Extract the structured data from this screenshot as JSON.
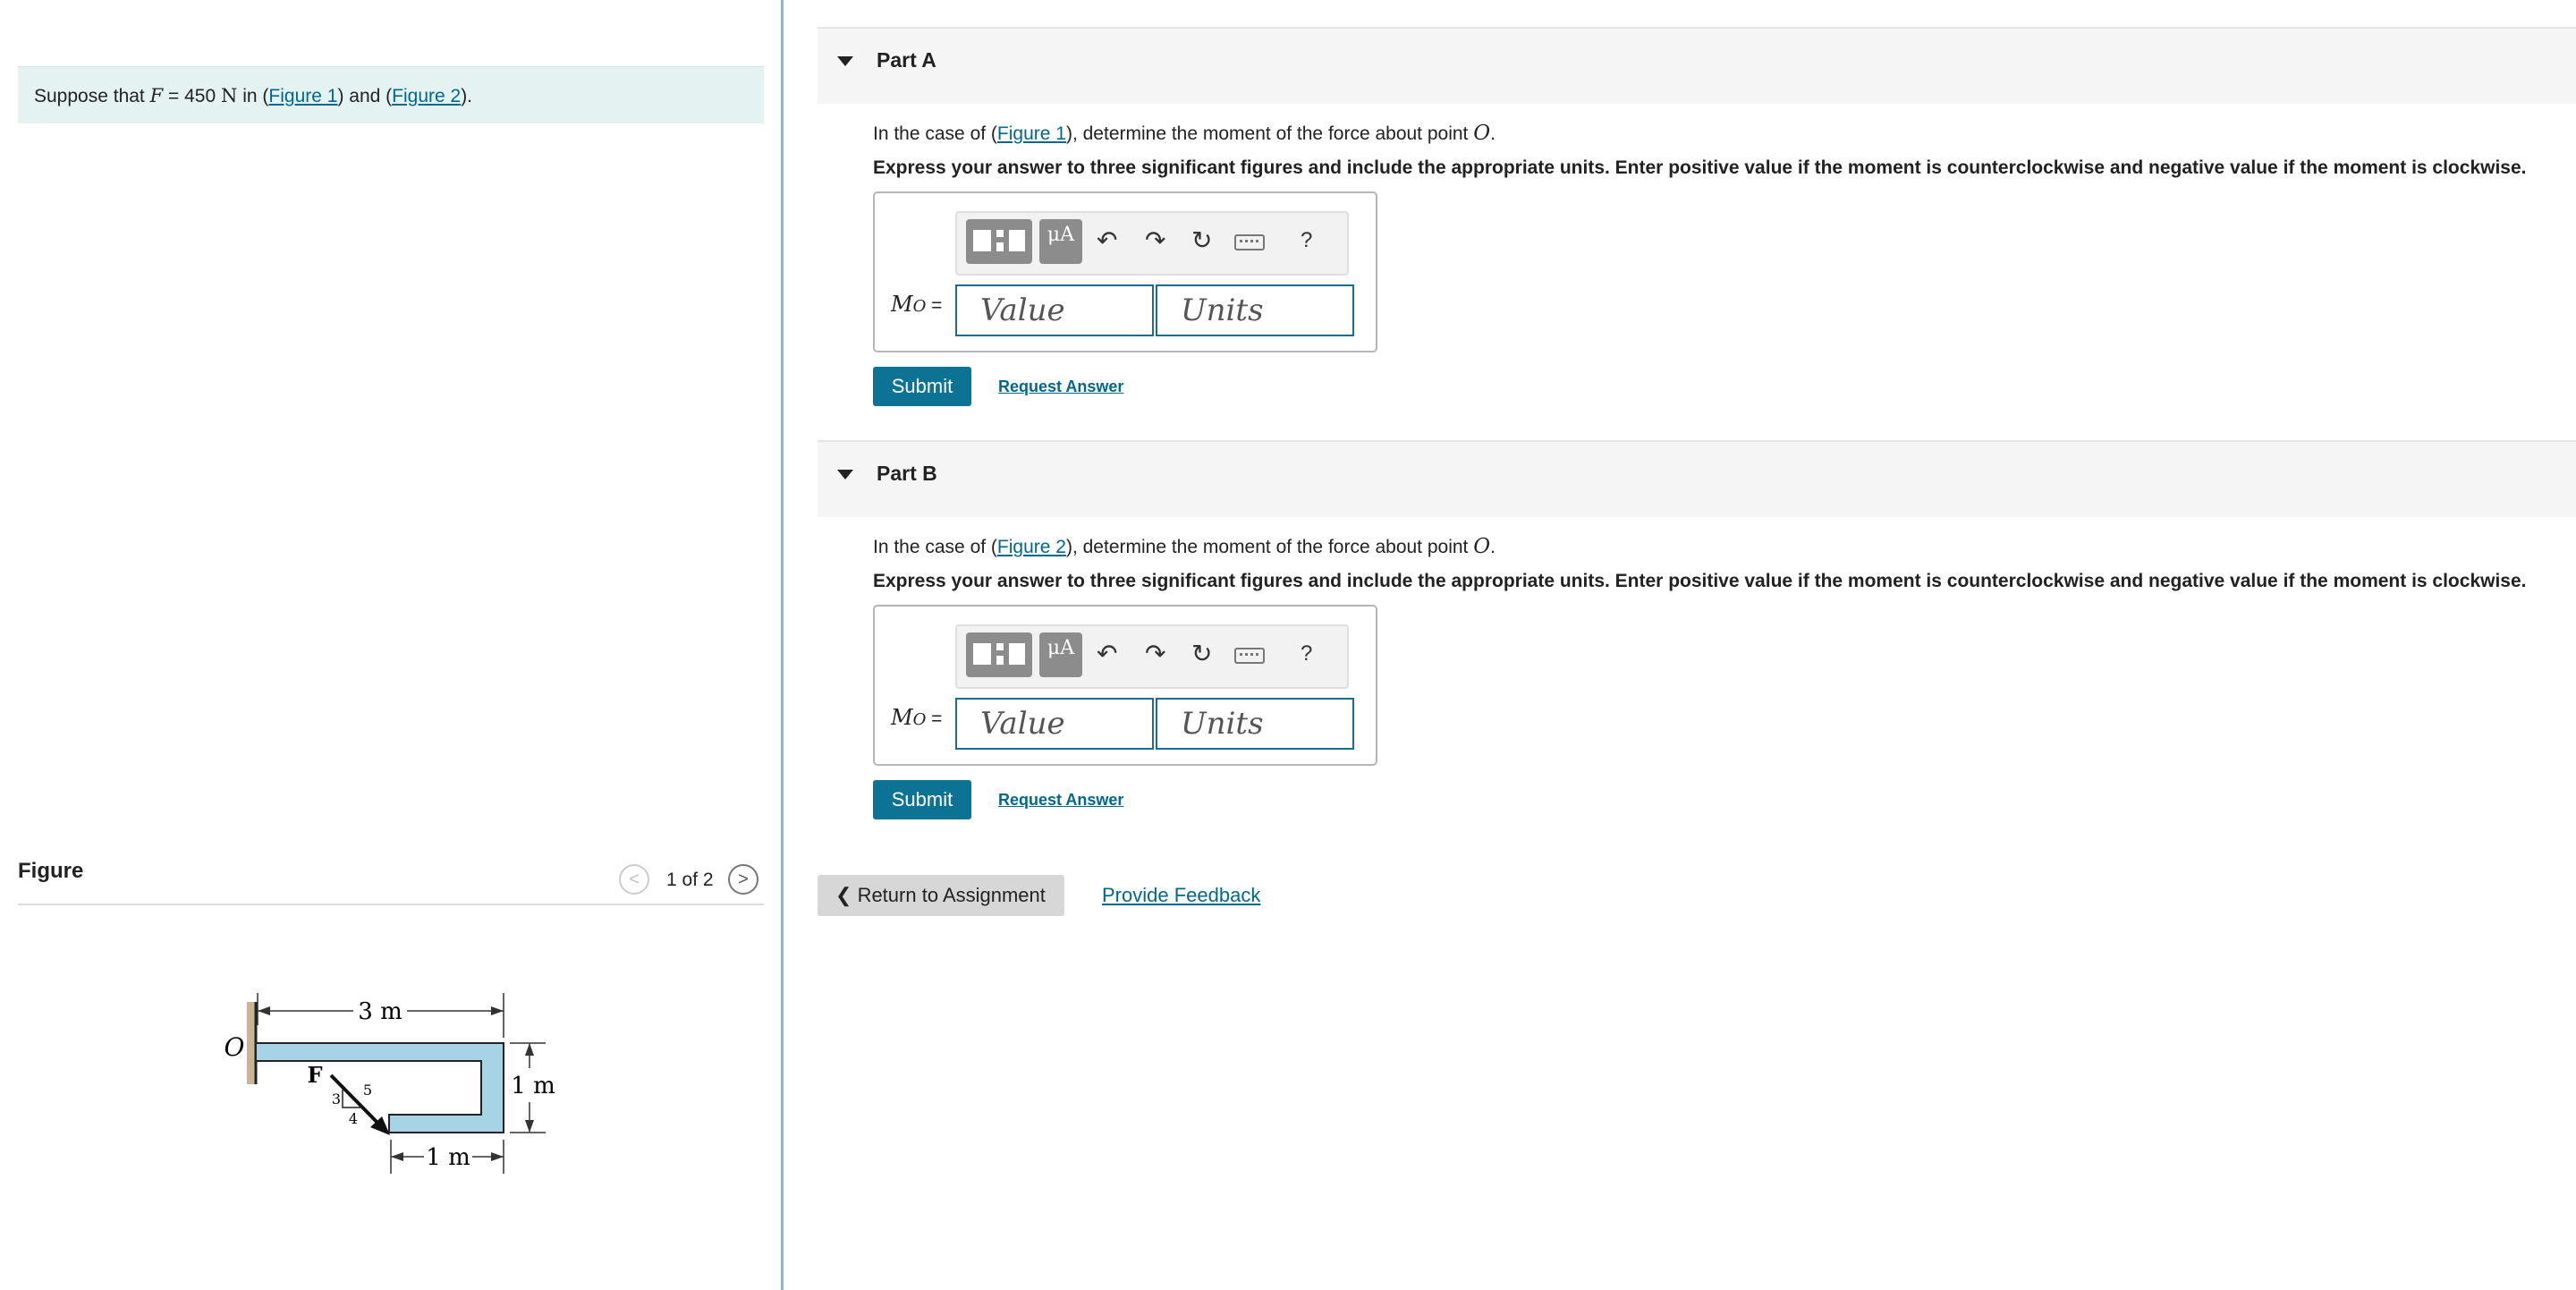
{
  "problem": {
    "prefix": "Suppose that ",
    "var": "F",
    "mid": " = 450 ",
    "unit": "N",
    "in_text": " in (",
    "fig1_link": "Figure 1",
    "and_text": ") and (",
    "fig2_link": "Figure 2",
    "end_text": ")."
  },
  "figure_panel": {
    "title": "Figure",
    "page_indicator": "1 of 2",
    "prev_icon": "chevron-left-icon",
    "next_icon": "chevron-right-icon",
    "prev_glyph": "<",
    "next_glyph": ">",
    "labels": {
      "origin": "O",
      "top_dim": "3 m",
      "right_dim": "1 m",
      "bottom_dim": "1 m",
      "force": "F",
      "tri_3": "3",
      "tri_4": "4",
      "tri_5": "5"
    }
  },
  "toolbar": {
    "template_icon": "templates-icon",
    "mu_label": "μA",
    "undo_glyph": "↶",
    "redo_glyph": "↷",
    "reset_glyph": "↻",
    "keyboard_icon": "keyboard-icon",
    "help_glyph": "?"
  },
  "parts": [
    {
      "title": "Part A",
      "q_prefix": "In the case of (",
      "q_link": "Figure 1",
      "q_suffix": "), determine the moment of the force about point ",
      "q_point": "O",
      "q_end": ".",
      "instructions": "Express your answer to three significant figures and include the appropriate units. Enter positive value if the moment is counterclockwise and negative value if the moment is clockwise.",
      "label_main": "M",
      "label_sub": "O",
      "label_eq": " =",
      "value_placeholder": "Value",
      "units_placeholder": "Units",
      "submit": "Submit",
      "request": "Request Answer"
    },
    {
      "title": "Part B",
      "q_prefix": "In the case of (",
      "q_link": "Figure 2",
      "q_suffix": "), determine the moment of the force about point ",
      "q_point": "O",
      "q_end": ".",
      "instructions": "Express your answer to three significant figures and include the appropriate units. Enter positive value if the moment is counterclockwise and negative value if the moment is clockwise.",
      "label_main": "M",
      "label_sub": "O",
      "label_eq": " =",
      "value_placeholder": "Value",
      "units_placeholder": "Units",
      "submit": "Submit",
      "request": "Request Answer"
    }
  ],
  "footer": {
    "return_glyph": "❮",
    "return_label": "Return to Assignment",
    "feedback_label": "Provide Feedback"
  },
  "colors": {
    "accent": "#0d7395",
    "link": "#00688d",
    "problem_bg": "#e4f3f1",
    "beam_fill": "#a7d3e6"
  }
}
